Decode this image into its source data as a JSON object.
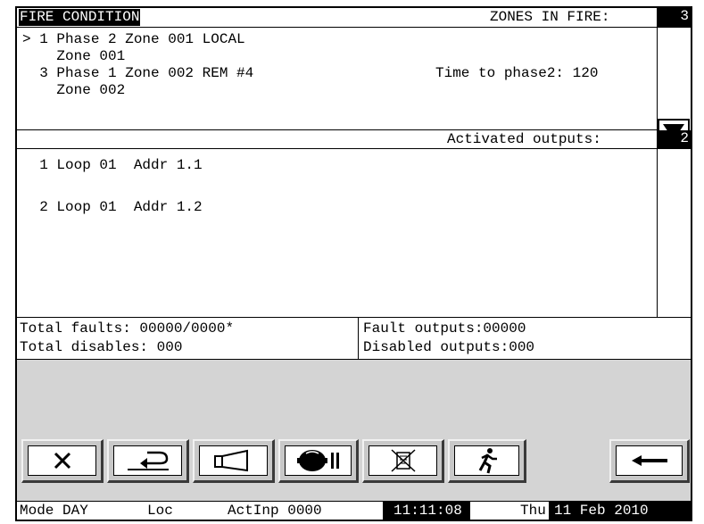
{
  "header": {
    "title": "FIRE CONDITION",
    "zones_label": "ZONES IN FIRE:",
    "zones_count": "3"
  },
  "fire_list": {
    "items": [
      {
        "line1": "> 1 Phase 2 Zone 001 LOCAL",
        "line2": "    Zone 001"
      },
      {
        "line1": "  3 Phase 1 Zone 002 REM #4",
        "line2": "    Zone 002"
      }
    ],
    "time_to_phase": "Time to phase2: 120"
  },
  "outputs": {
    "label": "Activated outputs:",
    "count": "2",
    "items": [
      "  1 Loop 01  Addr 1.1",
      "  2 Loop 01  Addr 1.2"
    ]
  },
  "summary": {
    "total_faults": "Total faults: 00000/0000*",
    "total_disables": "Total disables: 000",
    "fault_outputs": "Fault outputs:00000",
    "disabled_outputs": "Disabled outputs:000"
  },
  "buttons": [
    {
      "name": "close-button",
      "icon": "close-icon"
    },
    {
      "name": "back-button",
      "icon": "return-arrow-icon"
    },
    {
      "name": "sounder-button",
      "icon": "horn-icon"
    },
    {
      "name": "silence-alarm-button",
      "icon": "bell-pause-icon"
    },
    {
      "name": "mute-buzzer-button",
      "icon": "buzzer-mute-icon"
    },
    {
      "name": "evacuate-button",
      "icon": "running-man-icon"
    },
    {
      "name": "left-arrow-button",
      "icon": "arrow-left-icon"
    }
  ],
  "status_bar": {
    "mode": "Mode DAY",
    "loc": "Loc",
    "act_inp": "ActInp 0000",
    "time": "11:11:08",
    "day": "Thu",
    "date": "11 Feb 2010"
  },
  "colors": {
    "panel_grey": "#d4d4d4",
    "button_grey": "#c8c8c8"
  }
}
